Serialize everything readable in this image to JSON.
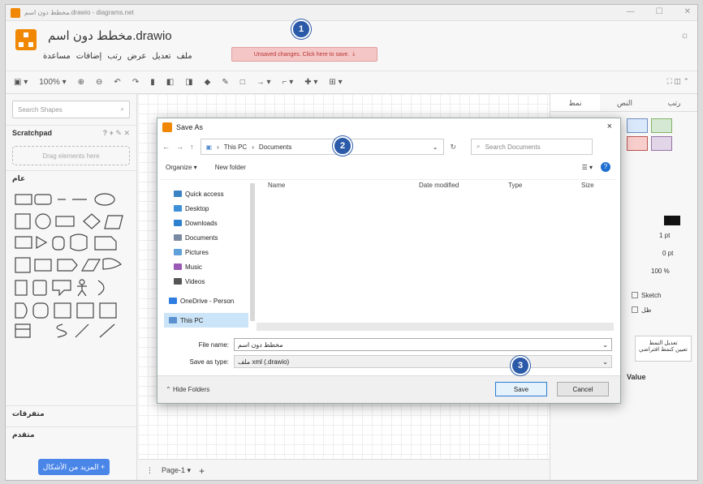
{
  "window": {
    "title": "مخطط دون اسم.drawio - diagrams.net"
  },
  "header": {
    "doc_title": "مخطط دون اسم.drawio",
    "menu": [
      "ملف",
      "تعديل",
      "عرض",
      "رتب",
      "إضافات",
      "مساعدة"
    ],
    "unsaved_label": "Unsaved changes. Click here to save."
  },
  "toolbar": {
    "zoom": "100%"
  },
  "sidebar": {
    "search_placeholder": "Search Shapes",
    "scratchpad": "Scratchpad",
    "drag_here": "Drag elements here",
    "general": "عام",
    "misc": "متفرقات",
    "advanced": "متقدم",
    "more_shapes": "المزيد من الأشكال +"
  },
  "pagebar": {
    "page_tab": "Page-1"
  },
  "rpanel": {
    "tabs": [
      "نمط",
      "النص",
      "رتب"
    ],
    "opacity": "100 %",
    "line_width": "1 pt",
    "spacing": "0 pt",
    "sketch": "Sketch",
    "shadow": "ظل",
    "value_header": "Value",
    "edit_style": "تعديل النمط",
    "default_style": "تعيين كنمط افتراضي"
  },
  "dialog": {
    "title": "Save As",
    "close": "×",
    "breadcrumb": [
      "This PC",
      "Documents"
    ],
    "search_placeholder": "Search Documents",
    "organize": "Organize ▾",
    "new_folder": "New folder",
    "columns": [
      "Name",
      "Date modified",
      "Type",
      "Size"
    ],
    "nav": [
      {
        "label": "Quick access",
        "color": "#3b82c4"
      },
      {
        "label": "Desktop",
        "color": "#3d8fd8"
      },
      {
        "label": "Downloads",
        "color": "#2d7fd0"
      },
      {
        "label": "Documents",
        "color": "#7a8aa0"
      },
      {
        "label": "Pictures",
        "color": "#5fa0d8"
      },
      {
        "label": "Music",
        "color": "#9b59b6"
      },
      {
        "label": "Videos",
        "color": "#555555"
      },
      {
        "label": "OneDrive - Person",
        "color": "#2f7de0"
      },
      {
        "label": "This PC",
        "color": "#5a8fd0"
      }
    ],
    "file_name_label": "File name:",
    "file_name_value": "مخطط دون اسم",
    "save_type_label": "Save as type:",
    "save_type_value": "ملف xml (.drawio)",
    "hide_folders": "Hide Folders",
    "save": "Save",
    "cancel": "Cancel"
  },
  "badges": [
    "1",
    "2",
    "3"
  ]
}
